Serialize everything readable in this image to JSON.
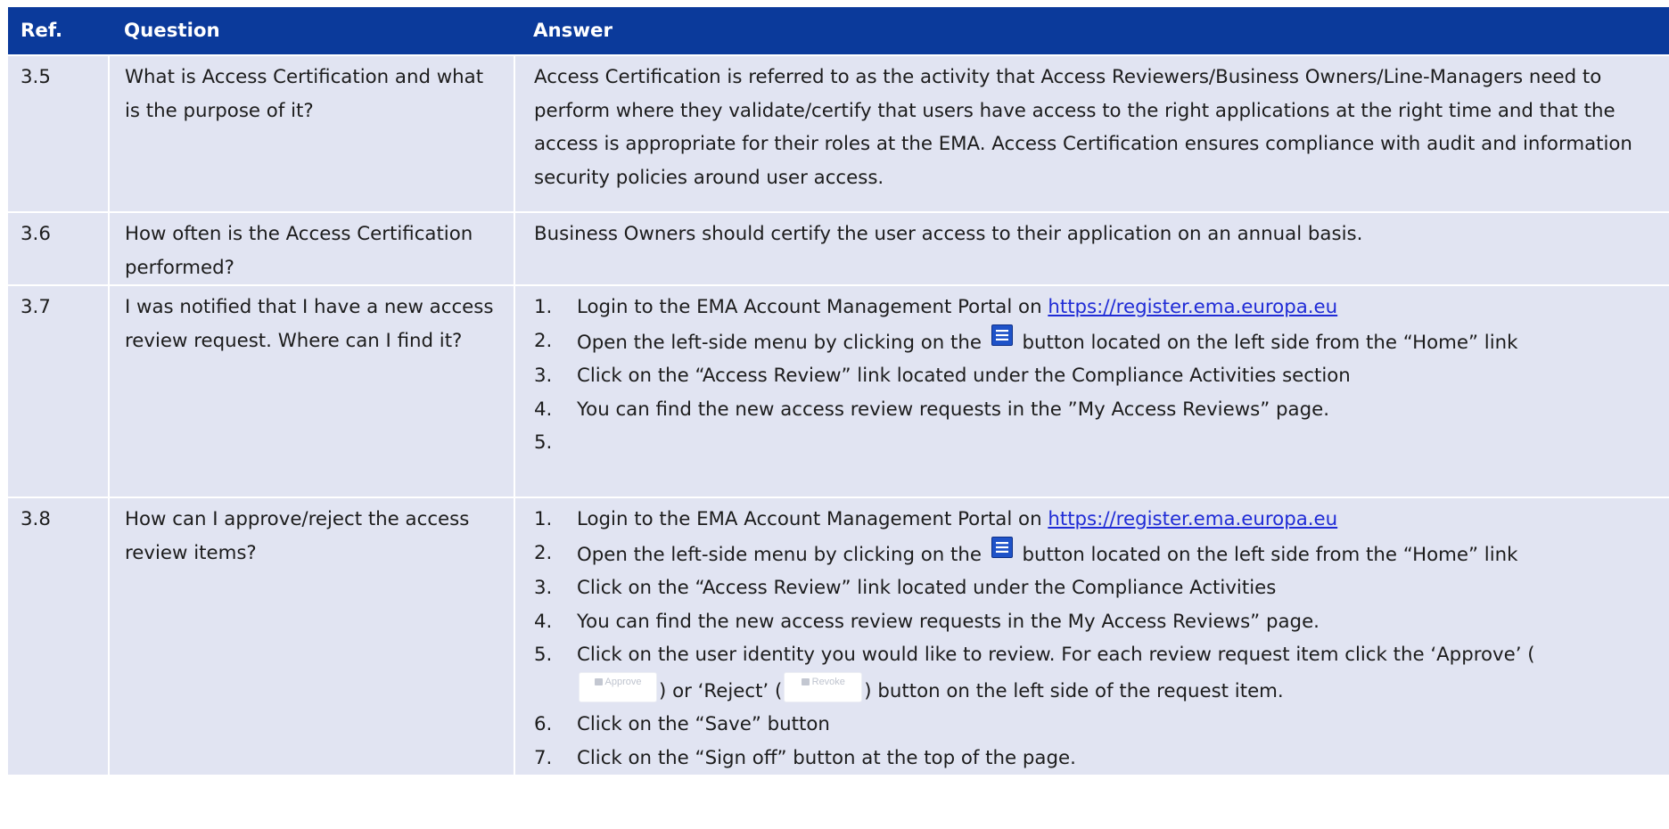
{
  "header": {
    "ref": "Ref.",
    "question": "Question",
    "answer": "Answer"
  },
  "rows": [
    {
      "ref": "3.5",
      "question": "What is Access Certification and what is the purpose of it?",
      "answer": "Access Certification is referred to as the activity that Access Reviewers/Business Owners/Line-Managers need to perform where they validate/certify that users have access to the right applications at the right time and that the access is appropriate for their roles at the EMA. Access Certification ensures compliance with audit and information security policies around user access."
    },
    {
      "ref": "3.6",
      "question": "How often is the Access Certification performed?",
      "answer": "Business Owners should certify the user access to their application on an annual basis."
    },
    {
      "ref": "3.7",
      "question": "I was notified that I have a new access review request. Where can I find it?",
      "steps": {
        "n1": "1.",
        "s1_text": "Login to the EMA Account Management Portal on ",
        "link": "https://register.ema.europa.eu",
        "n2": "2.",
        "s2_before": "Open the left-side menu by clicking on the ",
        "s2_after": " button located on the left side from the “Home” link",
        "n3": "3.",
        "s3": "Click on the “Access Review” link located under the Compliance Activities section",
        "n4": "4.",
        "s4": "You can find the new access review requests in the ”My Access Reviews” page.",
        "n5": "5."
      }
    },
    {
      "ref": "3.8",
      "question": "How can I approve/reject the access review items?",
      "steps": {
        "n1": "1.",
        "s1_text": "Login to the EMA Account Management Portal on ",
        "link": "https://register.ema.europa.eu",
        "n2": "2.",
        "s2_before": "Open the left-side menu by clicking on the ",
        "s2_after": " button located on the left side from the “Home” link",
        "n3": "3.",
        "s3": "Click on the “Access Review” link located under the Compliance Activities",
        "n4": "4.",
        "s4": "You can find the new access review requests in the My Access Reviews” page.",
        "n5": "5.",
        "s5_part1": "Click on the user identity you would like to review. For each review request item click the ‘Approve’ (",
        "approve_chip": "Approve",
        "s5_part2": ") or ‘Reject’ (",
        "revoke_chip": "Revoke",
        "s5_part3": ") button on the left side of the request item.",
        "n6": "6.",
        "s6": "Click on the “Save” button",
        "n7": "7.",
        "s7": "Click on the “Sign off” button at the top of the page."
      }
    }
  ],
  "icons": {
    "menu": "menu-list-icon",
    "approve": "thumbs-up-icon",
    "revoke": "thumbs-down-icon",
    "menu_color": "#1e52c8"
  }
}
